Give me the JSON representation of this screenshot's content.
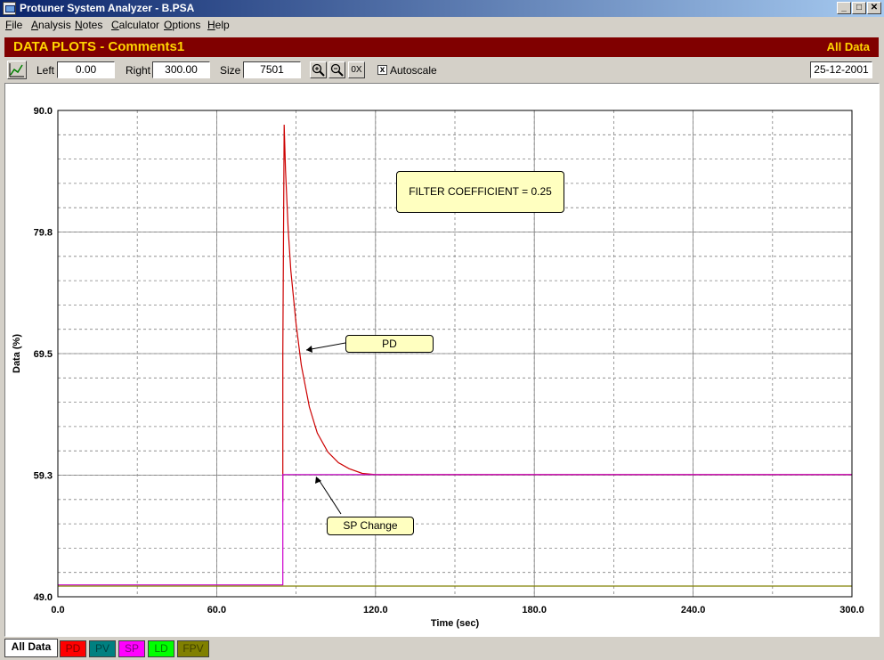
{
  "window": {
    "title": "Protuner System Analyzer - B.PSA"
  },
  "menu": [
    {
      "label": "File",
      "u": "F",
      "rest": "ile"
    },
    {
      "label": "Analysis",
      "u": "A",
      "rest": "nalysis"
    },
    {
      "label": "Notes",
      "u": "N",
      "rest": "otes"
    },
    {
      "label": "Calculator",
      "u": "C",
      "rest": "alculator"
    },
    {
      "label": "Options",
      "u": "O",
      "rest": "ptions"
    },
    {
      "label": "Help",
      "u": "H",
      "rest": "elp"
    }
  ],
  "header": {
    "title": "DATA PLOTS - Comments1",
    "scope": "All Data"
  },
  "toolbar": {
    "left_label": "Left",
    "left_value": "0.00",
    "right_label": "Right",
    "right_value": "300.00",
    "size_label": "Size",
    "size_value": "7501",
    "autoscale_label": "Autoscale",
    "autoscale_checked": "x",
    "date": "25-12-2001",
    "zoom_reset_label": "0X"
  },
  "annotations": {
    "filter": "FILTER COEFFICIENT = 0.25",
    "pd": "PD",
    "sp": "SP Change"
  },
  "tabs": [
    "All Data",
    "PD",
    "PV",
    "SP",
    "LD",
    "FPV"
  ],
  "colors": {
    "pd": "#cc0000",
    "sp": "#cc00cc",
    "ld": "#808000",
    "header_bg": "#800000",
    "header_fg": "#ffd400"
  },
  "chart_data": {
    "type": "line",
    "xlabel": "Time (sec)",
    "ylabel": "Data (%)",
    "xlim": [
      0,
      300
    ],
    "ylim": [
      49.0,
      90.0
    ],
    "x_ticks": [
      "0.0",
      "60.0",
      "120.0",
      "180.0",
      "240.0",
      "300.0"
    ],
    "y_ticks": [
      "49.0",
      "59.3",
      "69.5",
      "79.8",
      "90.0"
    ],
    "grid": true,
    "series": [
      {
        "name": "PD",
        "x": [
          85,
          85,
          85.5,
          86,
          87,
          88,
          90,
          92,
          95,
          98,
          102,
          106,
          110,
          115,
          120,
          300
        ],
        "y": [
          57,
          69.5,
          88.8,
          85,
          80,
          76.5,
          72,
          68.5,
          65,
          62.8,
          61.2,
          60.3,
          59.8,
          59.4,
          59.3,
          59.3
        ]
      },
      {
        "name": "SP",
        "x": [
          0,
          85,
          85,
          300
        ],
        "y": [
          50,
          50,
          59.3,
          59.3
        ]
      },
      {
        "name": "LD",
        "x": [
          0,
          300
        ],
        "y": [
          49.9,
          49.9
        ]
      }
    ]
  }
}
